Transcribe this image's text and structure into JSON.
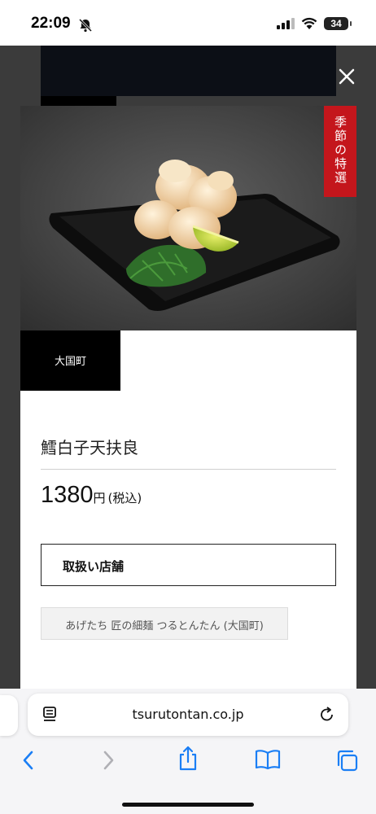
{
  "status": {
    "time": "22:09",
    "battery": "34"
  },
  "modal": {
    "season_label": "季節の特選",
    "store_tag": "大国町",
    "dish_name": "鱈白子天扶良",
    "price": {
      "amount": "1380",
      "unit": "円",
      "tax_note": "(税込)"
    },
    "shops_button": "取扱い店舗",
    "shop_chip": "あげたち 匠の細麺 つるとんたん (大国町)"
  },
  "browser": {
    "url": "tsurutontan.co.jp"
  },
  "icons": [
    "bell-slash-icon",
    "signal-icon",
    "wifi-icon",
    "close-icon",
    "reader-icon",
    "reload-icon",
    "back-icon",
    "forward-icon",
    "share-icon",
    "bookmarks-icon",
    "tabs-icon"
  ],
  "colors": {
    "season_banner": "#c4161c",
    "tag_bg": "#000000",
    "accent": "#1a7ef5"
  }
}
